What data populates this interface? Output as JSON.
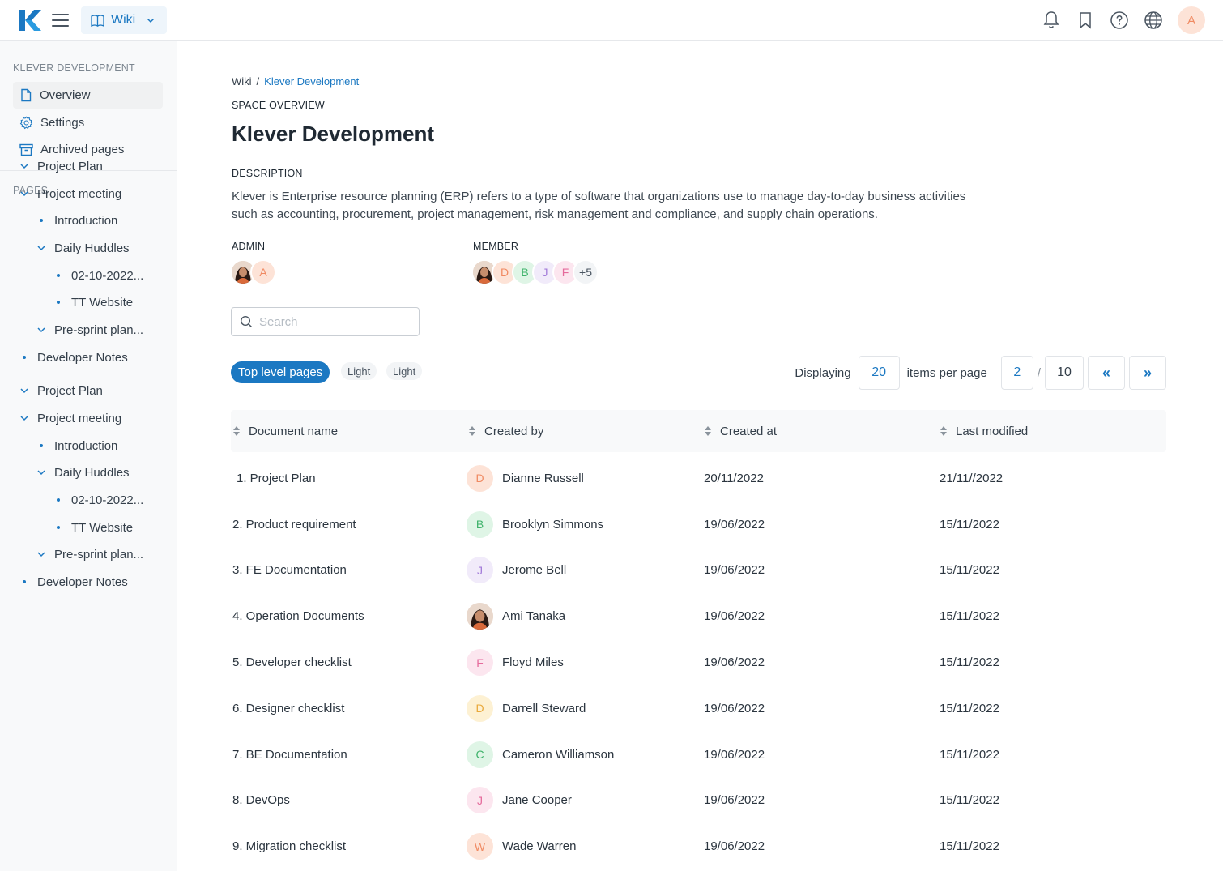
{
  "topbar": {
    "space_label": "Wiki",
    "user_initial": "A"
  },
  "sidebar": {
    "space_title": "KLEVER DEVELOPMENT",
    "top_items": [
      {
        "label": "Overview",
        "icon": "file-icon"
      },
      {
        "label": "Settings",
        "icon": "gear-icon"
      },
      {
        "label": "Archived pages",
        "icon": "archive-icon"
      }
    ],
    "pages_title": "PAGES",
    "pages": [
      {
        "label": "Project Plan"
      },
      {
        "label": "Project meeting"
      },
      {
        "label": "Introduction"
      },
      {
        "label": "Daily Huddles"
      },
      {
        "label": "02-10-2022..."
      },
      {
        "label": "TT Website"
      },
      {
        "label": "Pre-sprint plan..."
      },
      {
        "label": "Developer Notes"
      },
      {
        "label": "Project Plan"
      },
      {
        "label": "Project meeting"
      },
      {
        "label": "Introduction"
      },
      {
        "label": "Daily Huddles"
      },
      {
        "label": "02-10-2022..."
      },
      {
        "label": "TT Website"
      },
      {
        "label": "Pre-sprint plan..."
      },
      {
        "label": "Developer Notes"
      }
    ]
  },
  "main": {
    "breadcrumb": {
      "root": "Wiki",
      "separator": "/",
      "current": "Klever Development"
    },
    "overline": "SPACE OVERVIEW",
    "title": "Klever Development",
    "description_label": "DESCRIPTION",
    "description": "Klever is Enterprise resource planning (ERP) refers to a type of software that organizations use to manage day-to-day business activities such as accounting, procurement, project management, risk management and compliance, and supply chain operations.",
    "admin_label": "ADMIN",
    "admin_initials": [
      "A"
    ],
    "member_label": "MEMBER",
    "member_initials": [
      "D",
      "B",
      "J",
      "F"
    ],
    "member_more": "+5",
    "search_placeholder": "Search",
    "filters": {
      "primary": "Top level pages",
      "light_1": "Light",
      "light_2": "Light"
    },
    "pager": {
      "displaying_label": "Displaying",
      "per_page": "20",
      "items_per_page_label": "items per page",
      "current_page": "2",
      "separator": "/",
      "total_pages": "10",
      "prev": "«",
      "next": "»"
    },
    "table": {
      "headers": [
        "Document name",
        "Created by",
        "Created at",
        "Last modified"
      ],
      "rows": [
        {
          "name": "1. Project Plan",
          "initial": "D",
          "creator": "Dianne Russell",
          "created": "20/11/2022",
          "modified": "21/11//2022"
        },
        {
          "name": "2. Product requirement",
          "initial": "B",
          "creator": "Brooklyn Simmons",
          "created": "19/06/2022",
          "modified": "15/11/2022"
        },
        {
          "name": "3. FE Documentation",
          "initial": "J",
          "creator": "Jerome Bell",
          "created": "19/06/2022",
          "modified": "15/11/2022"
        },
        {
          "name": "4. Operation Documents",
          "initial": "",
          "creator": "Ami Tanaka",
          "created": "19/06/2022",
          "modified": "15/11/2022"
        },
        {
          "name": "5. Developer checklist",
          "initial": "F",
          "creator": "Floyd Miles",
          "created": "19/06/2022",
          "modified": "15/11/2022"
        },
        {
          "name": "6. Designer checklist",
          "initial": "D",
          "creator": "Darrell Steward",
          "created": "19/06/2022",
          "modified": "15/11/2022"
        },
        {
          "name": "7. BE Documentation",
          "initial": "C",
          "creator": "Cameron Williamson",
          "created": "19/06/2022",
          "modified": "15/11/2022"
        },
        {
          "name": "8. DevOps",
          "initial": "J",
          "creator": "Jane Cooper",
          "created": "19/06/2022",
          "modified": "15/11/2022"
        },
        {
          "name": "9. Migration checklist",
          "initial": "W",
          "creator": "Wade Warren",
          "created": "19/06/2022",
          "modified": "15/11/2022"
        }
      ]
    }
  },
  "colors": {
    "accent": "#1b78c2",
    "logo_blue": "#1b78c2",
    "avatar_orange_bg": "#fde3d7",
    "avatar_orange_fg": "#f08a62",
    "avatar_green_bg": "#dff5e6",
    "avatar_green_fg": "#3fb36b",
    "avatar_purple_bg": "#f1ebfa",
    "avatar_purple_fg": "#a27bd9",
    "avatar_pink_bg": "#fce6ef",
    "avatar_pink_fg": "#e56b9c",
    "avatar_yellow_bg": "#fdf1d3",
    "avatar_yellow_fg": "#e9a93a"
  }
}
